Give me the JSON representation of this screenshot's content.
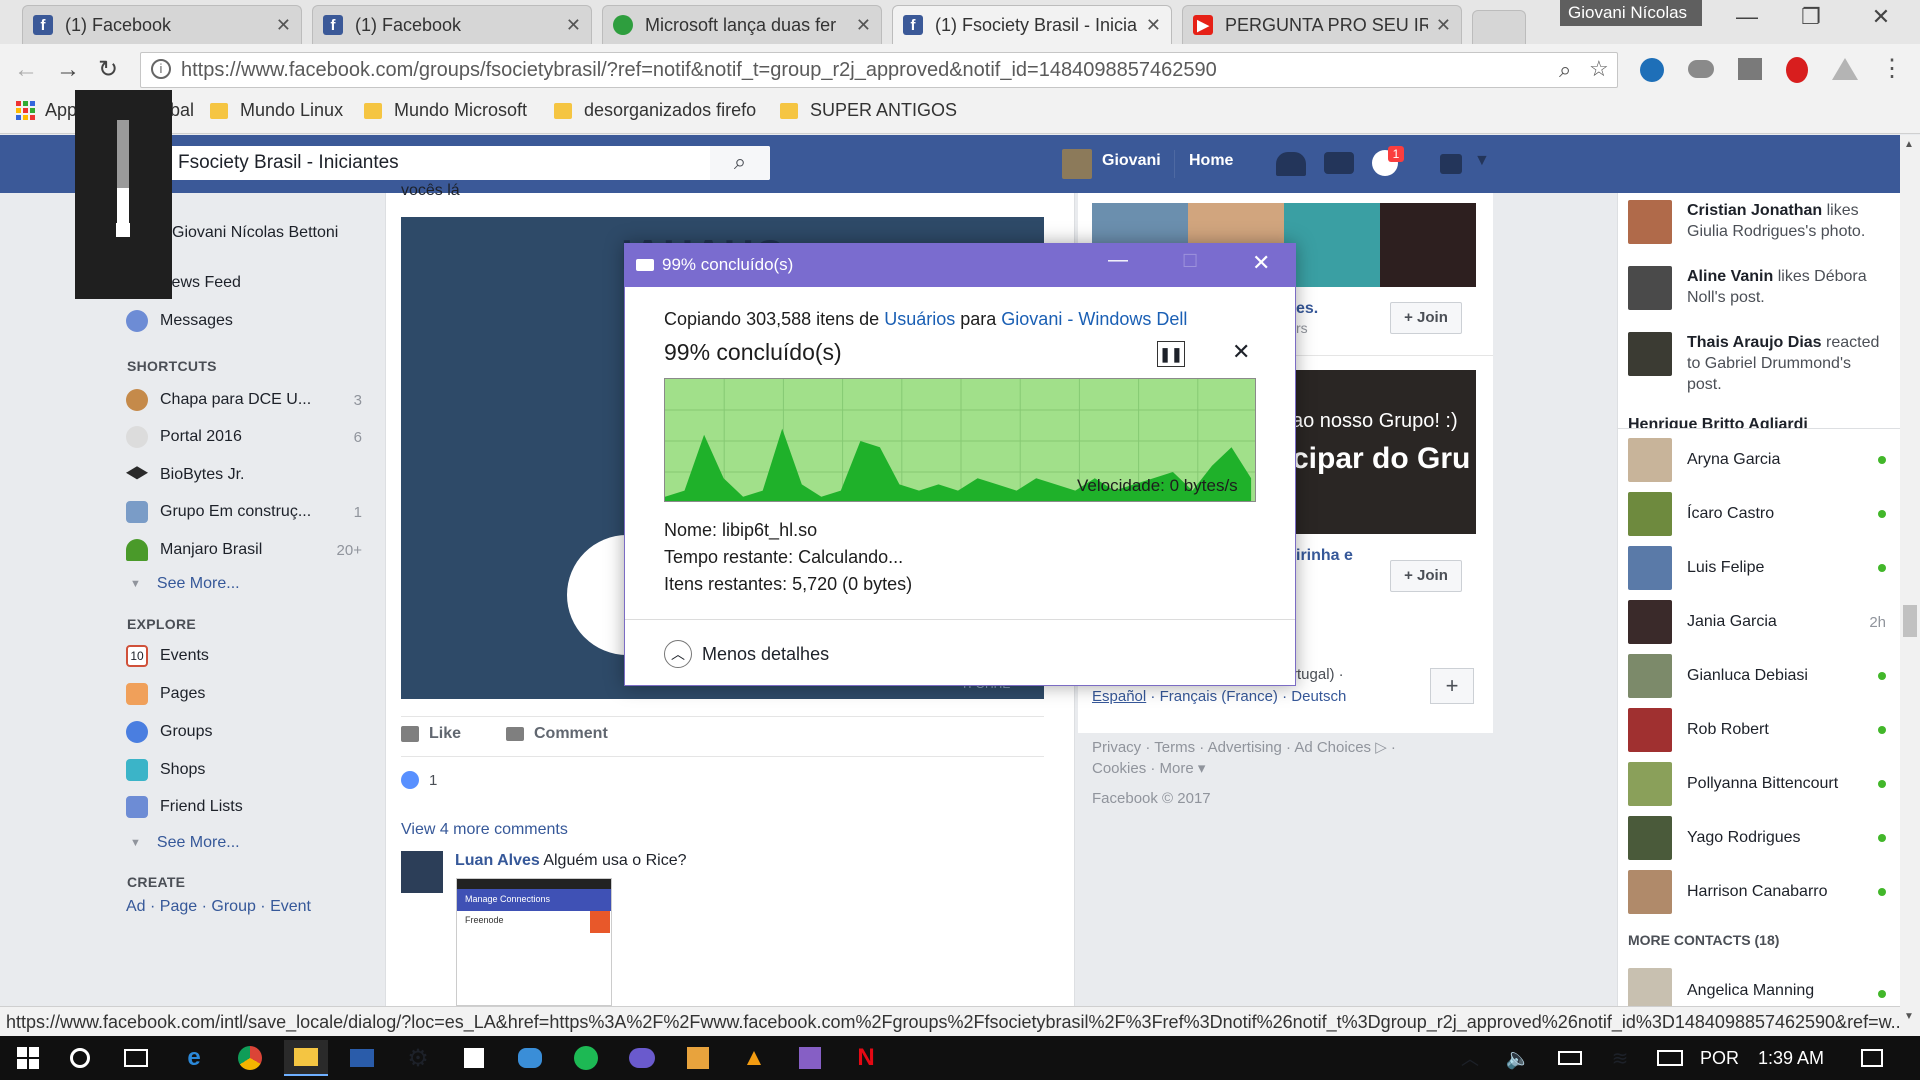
{
  "browser": {
    "tabs": [
      {
        "title": "(1) Facebook",
        "icon": "facebook-icon",
        "color": "#3b5998"
      },
      {
        "title": "(1) Facebook",
        "icon": "facebook-icon",
        "color": "#3b5998"
      },
      {
        "title": "Microsoft lança duas fer",
        "icon": "globe-icon",
        "color": "#2e9e3e"
      },
      {
        "title": "(1) Fsociety Brasil - Inicia",
        "icon": "facebook-icon",
        "color": "#3b5998"
      },
      {
        "title": "PERGUNTA PRO SEU IRM",
        "icon": "youtube-icon",
        "color": "#e62117"
      }
    ],
    "profile_name": "Giovani Nícolas",
    "url": "https://www.facebook.com/groups/fsocietybrasil/?ref=notif&notif_t=group_r2j_approved&notif_id=1484098857462590",
    "bookmarks": [
      "Apps",
      "Global",
      "Mundo Linux",
      "Mundo Microsoft",
      "desorganizados firefo",
      "SUPER ANTIGOS"
    ],
    "status_url": "https://www.facebook.com/intl/save_locale/dialog/?loc=es_LA&href=https%3A%2F%2Fwww.facebook.com%2Fgroups%2Ffsocietybrasil%2F%3Fref%3Dnotif%26notif_t%3Dgroup_r2j_approved%26notif_id%3D1484098857462590&ref=w..."
  },
  "facebook": {
    "search_value": "Fsociety Brasil - Iniciantes",
    "user_first": "Giovani",
    "home": "Home",
    "notif_count": "1",
    "left_nav": {
      "user_full": "Giovani Nícolas Bettoni",
      "news_feed": "News Feed",
      "messages": "Messages",
      "shortcuts_title": "SHORTCUTS",
      "shortcuts": [
        {
          "label": "Chapa para DCE U...",
          "count": "3"
        },
        {
          "label": "Portal 2016",
          "count": "6"
        },
        {
          "label": "BioBytes Jr.",
          "count": ""
        },
        {
          "label": "Grupo Em construç...",
          "count": "1"
        },
        {
          "label": "Manjaro Brasil",
          "count": "20+"
        }
      ],
      "see_more": "See More...",
      "explore_title": "EXPLORE",
      "explore": [
        "Events",
        "Pages",
        "Groups",
        "Shops",
        "Friend Lists"
      ],
      "create_title": "CREATE",
      "create": [
        "Ad",
        "Page",
        "Group",
        "Event"
      ]
    },
    "post": {
      "top_text": "vocês lá",
      "like": "Like",
      "comment": "Comment",
      "likes_count": "1",
      "view_more": "View 4 more comments",
      "comment_author": "Luan Alves",
      "comment_text": "Alguém usa o Rice?",
      "thumb_title": "Manage Connections",
      "thumb_item": "Freenode",
      "image_text": "IAHAHC",
      "image_tag": "TFOHHE"
    },
    "right": {
      "join": "Join",
      "promo_line1": "ao nosso Grupo! :)",
      "promo_line2": "cipar do Gru",
      "group_name_a": "es.",
      "group_meta_a": "rs",
      "group_name_b": "irinha e",
      "lang_line": "rtugal) ·",
      "languages": [
        "Español",
        "Français (France)",
        "Deutsch"
      ],
      "footer_links": [
        "Privacy",
        "Terms",
        "Advertising",
        "Ad Choices",
        "Cookies",
        "More"
      ],
      "copyright": "Facebook © 2017"
    },
    "ticker": [
      {
        "name": "Cristian Jonathan",
        "text": "likes Giulia Rodrigues's photo."
      },
      {
        "name": "Aline Vanin",
        "text": "likes Débora Noll's post."
      },
      {
        "name": "Thais Araujo Dias",
        "text": "reacted to Gabriel Drummond's post."
      },
      {
        "name": "Henrique Britto Agliardi",
        "text": ""
      }
    ],
    "contacts": [
      {
        "name": "Aryna Garcia",
        "status": "online"
      },
      {
        "name": "Ícaro Castro",
        "status": "online"
      },
      {
        "name": "Luis Felipe",
        "status": "online"
      },
      {
        "name": "Jania Garcia",
        "status": "2h"
      },
      {
        "name": "Gianluca Debiasi",
        "status": "online"
      },
      {
        "name": "Rob Robert",
        "status": "online"
      },
      {
        "name": "Pollyanna Bittencourt",
        "status": "online"
      },
      {
        "name": "Yago Rodrigues",
        "status": "online"
      },
      {
        "name": "Harrison Canabarro",
        "status": "online"
      }
    ],
    "more_contacts": "MORE CONTACTS (18)",
    "last_contact": "Angelica Manning"
  },
  "copy_dialog": {
    "title": "99% concluído(s)",
    "copy_prefix": "Copiando 303,588 itens de",
    "source": "Usuários",
    "between": "para",
    "destination": "Giovani - Windows Dell",
    "progress_text": "99% concluído(s)",
    "progress_percent": 99,
    "speed": "Velocidade: 0 bytes/s",
    "name_label": "Nome:",
    "name_value": "libip6t_hl.so",
    "time_label": "Tempo restante:",
    "time_value": "Calculando...",
    "items_label": "Itens restantes:",
    "items_value": "5,720 (0 bytes)",
    "less_details": "Menos detalhes",
    "speed_profile": [
      0.05,
      0.1,
      0.55,
      0.2,
      0.05,
      0.1,
      0.6,
      0.15,
      0.05,
      0.1,
      0.5,
      0.45,
      0.15,
      0.1,
      0.15,
      0.1,
      0.2,
      0.15,
      0.1,
      0.2,
      0.15,
      0.1,
      0.2,
      0.1,
      0.15,
      0.2,
      0.25,
      0.1,
      0.3,
      0.45,
      0.2
    ]
  },
  "taskbar": {
    "language": "POR",
    "time": "1:39 AM"
  },
  "colors": {
    "fb_blue": "#3b5998",
    "dialog_purple": "#7a6ccf",
    "graph_fill": "#1fb12a",
    "graph_bg": "#a1e08a",
    "online": "#42b72a"
  }
}
